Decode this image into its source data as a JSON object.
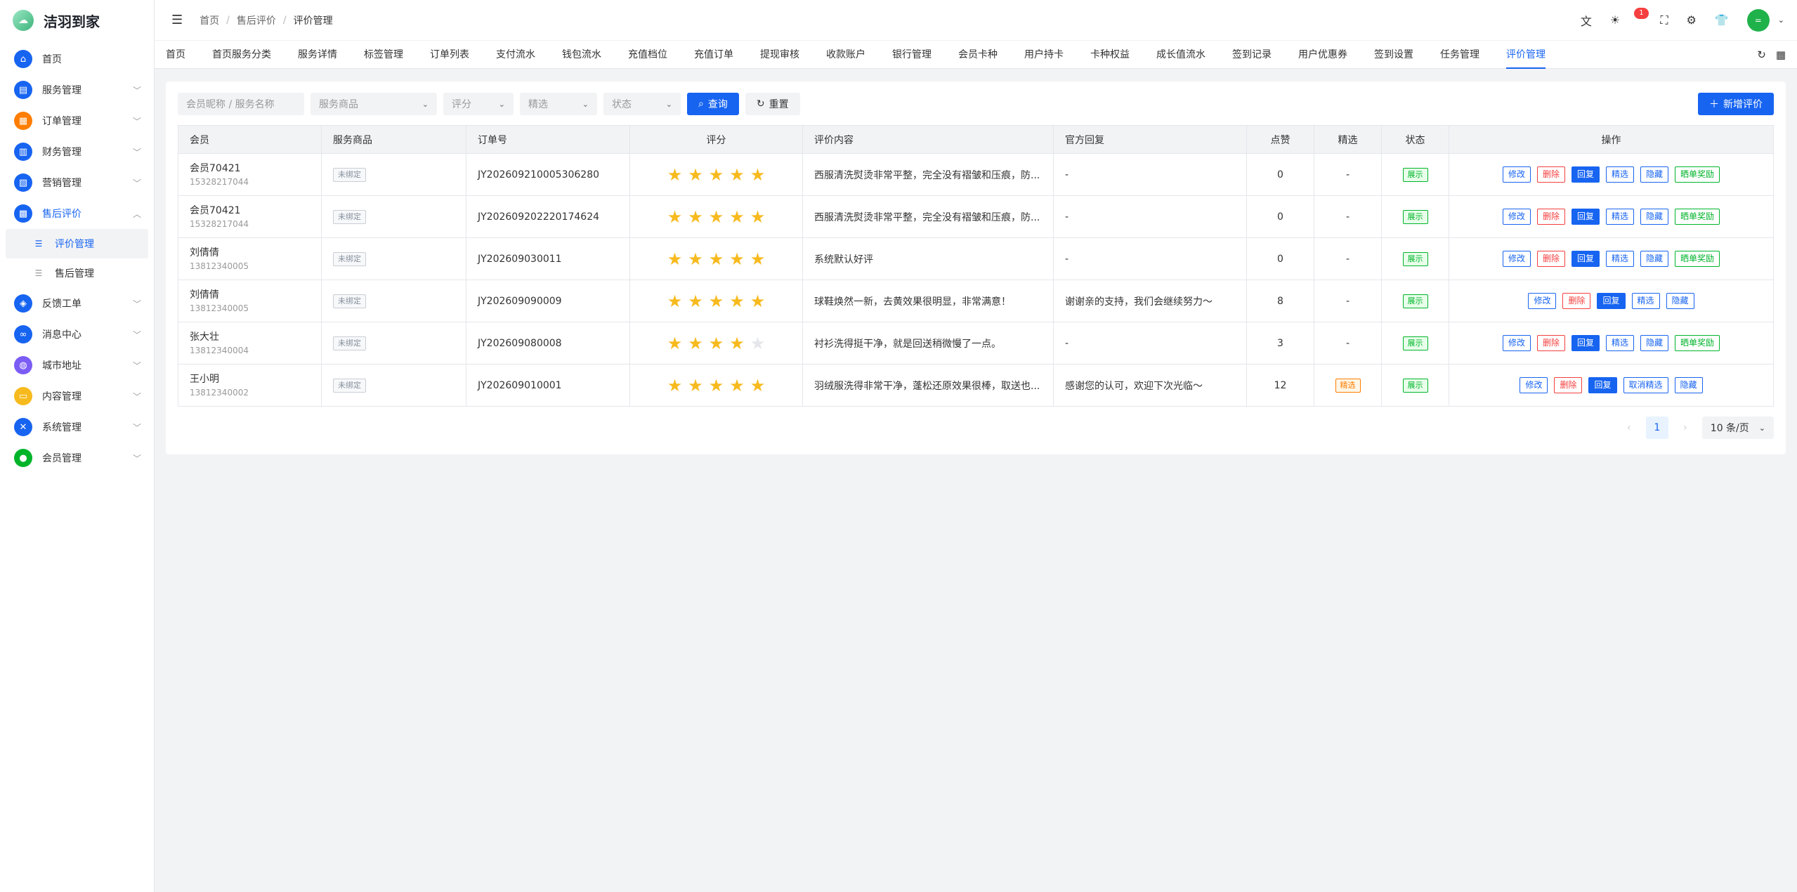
{
  "app": {
    "name": "洁羽到家"
  },
  "sidebar": {
    "items": [
      {
        "label": "首页",
        "icon": "home-icon",
        "color": "#1764f1",
        "glyph": "⌂",
        "arrow": false
      },
      {
        "label": "服务管理",
        "icon": "service-icon",
        "color": "#1764f1",
        "glyph": "▤",
        "arrow": true
      },
      {
        "label": "订单管理",
        "icon": "order-icon",
        "color": "#ff7d00",
        "glyph": "▦",
        "arrow": true
      },
      {
        "label": "财务管理",
        "icon": "finance-icon",
        "color": "#1764f1",
        "glyph": "▥",
        "arrow": true
      },
      {
        "label": "营销管理",
        "icon": "marketing-icon",
        "color": "#1764f1",
        "glyph": "▧",
        "arrow": true
      },
      {
        "label": "售后评价",
        "icon": "after-sales-icon",
        "color": "#1764f1",
        "glyph": "▩",
        "arrow": true,
        "open": true
      },
      {
        "label": "反馈工单",
        "icon": "feedback-icon",
        "color": "#1764f1",
        "glyph": "◈",
        "arrow": true
      },
      {
        "label": "消息中心",
        "icon": "message-icon",
        "color": "#1764f1",
        "glyph": "∞",
        "arrow": true
      },
      {
        "label": "城市地址",
        "icon": "planet-icon",
        "color": "#7b5cf5",
        "glyph": "◍",
        "arrow": true
      },
      {
        "label": "内容管理",
        "icon": "folder-icon",
        "color": "#f7ba1e",
        "glyph": "▭",
        "arrow": true
      },
      {
        "label": "系统管理",
        "icon": "tools-icon",
        "color": "#1764f1",
        "glyph": "✕",
        "arrow": true
      },
      {
        "label": "会员管理",
        "icon": "user-icon",
        "color": "#00b42a",
        "glyph": "●",
        "arrow": true
      }
    ],
    "submenu": [
      {
        "label": "评价管理",
        "active": true
      },
      {
        "label": "售后管理",
        "active": false
      }
    ]
  },
  "header": {
    "breadcrumb": [
      "首页",
      "售后评价",
      "评价管理"
    ],
    "badge": "1",
    "avatar_text": "="
  },
  "tabs": [
    "首页",
    "首页服务分类",
    "服务详情",
    "标签管理",
    "订单列表",
    "支付流水",
    "钱包流水",
    "充值档位",
    "充值订单",
    "提现审核",
    "收款账户",
    "银行管理",
    "会员卡种",
    "用户持卡",
    "卡种权益",
    "成长值流水",
    "签到记录",
    "用户优惠券",
    "签到设置",
    "任务管理",
    "评价管理"
  ],
  "active_tab": "评价管理",
  "filters": {
    "keyword_placeholder": "会员昵称 / 服务名称",
    "service_placeholder": "服务商品",
    "rating_placeholder": "评分",
    "featured_placeholder": "精选",
    "status_placeholder": "状态",
    "search_label": "查询",
    "reset_label": "重置",
    "add_label": "新增评价"
  },
  "table": {
    "headers": [
      "会员",
      "服务商品",
      "订单号",
      "评分",
      "评价内容",
      "官方回复",
      "点赞",
      "精选",
      "状态",
      "操作"
    ],
    "rows": [
      {
        "name": "会员70421",
        "phone": "15328217044",
        "service": "未绑定",
        "order": "JY202609210005306280",
        "rating": 5,
        "content": "西服清洗熨烫非常平整，完全没有褶皱和压痕，防...",
        "reply": "-",
        "likes": "0",
        "featured": "-",
        "status": "展示",
        "ops": [
          "修改",
          "删除",
          "回复",
          "精选",
          "隐藏",
          "晒单奖励"
        ]
      },
      {
        "name": "会员70421",
        "phone": "15328217044",
        "service": "未绑定",
        "order": "JY202609202220174624",
        "rating": 5,
        "content": "西服清洗熨烫非常平整，完全没有褶皱和压痕，防...",
        "reply": "-",
        "likes": "0",
        "featured": "-",
        "status": "展示",
        "ops": [
          "修改",
          "删除",
          "回复",
          "精选",
          "隐藏",
          "晒单奖励"
        ]
      },
      {
        "name": "刘倩倩",
        "phone": "13812340005",
        "service": "未绑定",
        "order": "JY202609030011",
        "rating": 5,
        "content": "系统默认好评",
        "reply": "-",
        "likes": "0",
        "featured": "-",
        "status": "展示",
        "ops": [
          "修改",
          "删除",
          "回复",
          "精选",
          "隐藏",
          "晒单奖励"
        ]
      },
      {
        "name": "刘倩倩",
        "phone": "13812340005",
        "service": "未绑定",
        "order": "JY202609090009",
        "rating": 5,
        "content": "球鞋焕然一新，去黄效果很明显，非常满意！",
        "reply": "谢谢亲的支持，我们会继续努力～",
        "likes": "8",
        "featured": "-",
        "status": "展示",
        "ops": [
          "修改",
          "删除",
          "回复",
          "精选",
          "隐藏"
        ]
      },
      {
        "name": "张大壮",
        "phone": "13812340004",
        "service": "未绑定",
        "order": "JY202609080008",
        "rating": 4,
        "content": "衬衫洗得挺干净，就是回送稍微慢了一点。",
        "reply": "-",
        "likes": "3",
        "featured": "-",
        "status": "展示",
        "ops": [
          "修改",
          "删除",
          "回复",
          "精选",
          "隐藏",
          "晒单奖励"
        ]
      },
      {
        "name": "王小明",
        "phone": "13812340002",
        "service": "未绑定",
        "order": "JY202609010001",
        "rating": 5,
        "content": "羽绒服洗得非常干净，蓬松还原效果很棒，取送也...",
        "reply": "感谢您的认可，欢迎下次光临～",
        "likes": "12",
        "featured": "精选",
        "status": "展示",
        "ops": [
          "修改",
          "删除",
          "回复",
          "取消精选",
          "隐藏"
        ]
      }
    ]
  },
  "pagination": {
    "current": "1",
    "page_size": "10 条/页"
  },
  "colors": {
    "primary": "#1764f1",
    "danger": "#f53f3f",
    "success": "#00b42a",
    "warning": "#ff7d00",
    "star": "#f7ba1e"
  }
}
